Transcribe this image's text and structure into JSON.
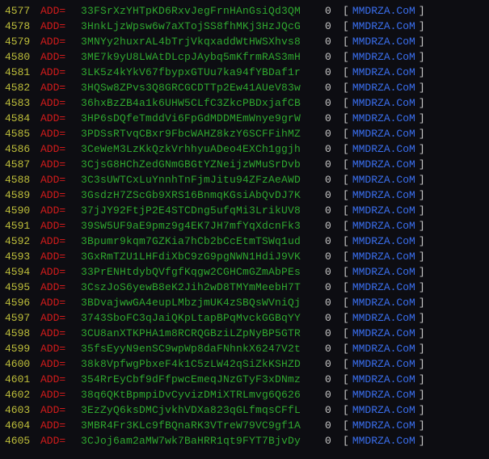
{
  "label": "ADD=",
  "domain": "MMDRZA.CoM",
  "status": "0",
  "bracket_open": "[",
  "bracket_close": "]",
  "rows": [
    {
      "n": "4577",
      "h": "33FSrXzYHTpKD6RxvJegFrnHAnGsiQd3QM"
    },
    {
      "n": "4578",
      "h": "3HnkLjzWpsw6w7aXTojSS8fhMKj3HzJQcG"
    },
    {
      "n": "4579",
      "h": "3MNYy2huxrAL4bTrjVkqxaddWtHWSXhvs8"
    },
    {
      "n": "4580",
      "h": "3ME7k9yU8LWAtDLcpJAybq5mKfrmRAS3mH"
    },
    {
      "n": "4581",
      "h": "3LK5z4kYkV67fbypxGTUu7ka94fYBDaf1r"
    },
    {
      "n": "4582",
      "h": "3HQSw8ZPvs3Q8GRCGCDTTp2Ew41AUeV83w"
    },
    {
      "n": "4583",
      "h": "36hxBzZB4a1k6UHW5CLfC3ZkcPBDxjafCB"
    },
    {
      "n": "4584",
      "h": "3HP6sDQfeTmddVi6FpGdMDDMEmWnye9grW"
    },
    {
      "n": "4585",
      "h": "3PDSsRTvqCBxr9FbcWAHZ8kzY6SCFFihMZ"
    },
    {
      "n": "4586",
      "h": "3CeWeM3LzKkQzkVrhhyuADeo4EXCh1ggjh"
    },
    {
      "n": "4587",
      "h": "3CjsG8HChZedGNmGBGtYZNeijzWMuSrDvb"
    },
    {
      "n": "4588",
      "h": "3C3sUWTCxLuYnnhTnFjmJitu94ZFzAeAWD"
    },
    {
      "n": "4589",
      "h": "3GsdzH7ZScGb9XRS16BnmqKGsiAbQvDJ7K"
    },
    {
      "n": "4590",
      "h": "37jJY92FtjP2E4STCDng5ufqMi3LrikUV8"
    },
    {
      "n": "4591",
      "h": "39SW5UF9aE9pmz9g4EK7JH7mfYqXdcnFk3"
    },
    {
      "n": "4592",
      "h": "3Bpumr9kqm7GZKia7hCb2bCcEtmTSWq1ud"
    },
    {
      "n": "4593",
      "h": "3GxRmTZU1LHFdiXbC9zG9pgNWN1HdiJ9VK"
    },
    {
      "n": "4594",
      "h": "33PrENHtdybQVfgfKqgw2CGHCmGZmAbPEs"
    },
    {
      "n": "4595",
      "h": "3CszJoS6yewB8eK2Jih2wD8TMYmMeebH7T"
    },
    {
      "n": "4596",
      "h": "3BDvajwwGA4eupLMbzjmUK4zSBQsWVniQj"
    },
    {
      "n": "4597",
      "h": "3743SboFC3qJaiQKpLtapBPqMvckGGBqYY"
    },
    {
      "n": "4598",
      "h": "3CU8anXTKPHA1m8RCRQGBziLZpNyBP5GTR"
    },
    {
      "n": "4599",
      "h": "35fsEyyN9enSC9wpWp8daFNhnkX6247V2t"
    },
    {
      "n": "4600",
      "h": "38k8VpfwgPbxeF4k1C5zLW42qSiZkKSHZD"
    },
    {
      "n": "4601",
      "h": "354RrEyCbf9dFfpwcEmeqJNzGTyF3xDNmz"
    },
    {
      "n": "4602",
      "h": "38q6QKtBpmpiDvCyvizDMiXTRLmvg6Q626"
    },
    {
      "n": "4603",
      "h": "3EzZyQ6ksDMCjvkhVDXa823qGLfmqsCFfL"
    },
    {
      "n": "4604",
      "h": "3MBR4Fr3KLc9fBQnaRK3VTreW79VC9gf1A"
    },
    {
      "n": "4605",
      "h": "3CJoj6am2aMW7wk7BaHRR1qt9FYT7BjvDy"
    }
  ]
}
